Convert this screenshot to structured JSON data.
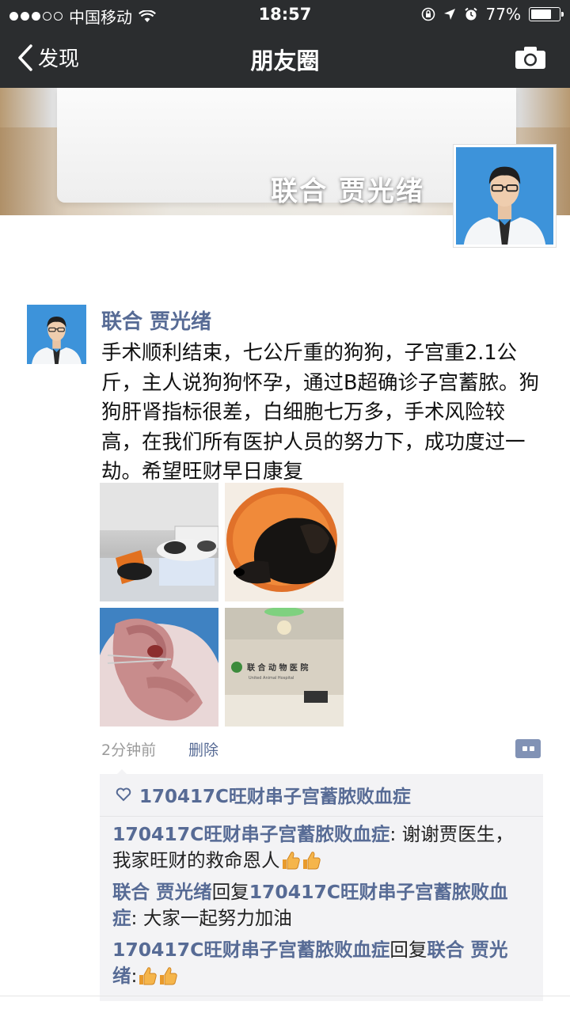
{
  "status_bar": {
    "carrier": "中国移动",
    "time": "18:57",
    "battery": "77%",
    "battery_level": 0.77
  },
  "nav": {
    "back_label": "发现",
    "title": "朋友圈"
  },
  "cover": {
    "name": "联合 贾光绪"
  },
  "post": {
    "author": "联合 贾光绪",
    "text": "手术顺利结束，七公斤重的狗狗，子宫重2.1公斤，主人说狗狗怀孕，通过B超确诊子宫蓄脓。狗狗肝肾指标很差，白细胞七万多，手术风险较高，在我们所有医护人员的努力下，成功度过一劫。希望旺财早日康复",
    "time": "2分钟前",
    "delete_label": "删除",
    "photo_sign_text": "联 合 动 物 医 院",
    "photo_sign_sub": "United Animal Hospital"
  },
  "likes": {
    "names": "170417C旺财串子宫蓄脓败血症"
  },
  "comments": [
    {
      "user": "170417C旺财串子宫蓄脓败血症",
      "reply_word": "",
      "reply_to": "",
      "text": ": 谢谢贾医生，我家旺财的救命恩人",
      "thumbs": 2
    },
    {
      "user": "联合 贾光绪",
      "reply_word": "回复",
      "reply_to": "170417C旺财串子宫蓄脓败血症",
      "text": ": 大家一起努力加油",
      "thumbs": 0
    },
    {
      "user": "170417C旺财串子宫蓄脓败血症",
      "reply_word": "回复",
      "reply_to": "联合 贾光绪",
      "text": ":",
      "thumbs": 2
    }
  ],
  "colors": {
    "link": "#576b95",
    "nav_bg": "#2b2d2f"
  }
}
